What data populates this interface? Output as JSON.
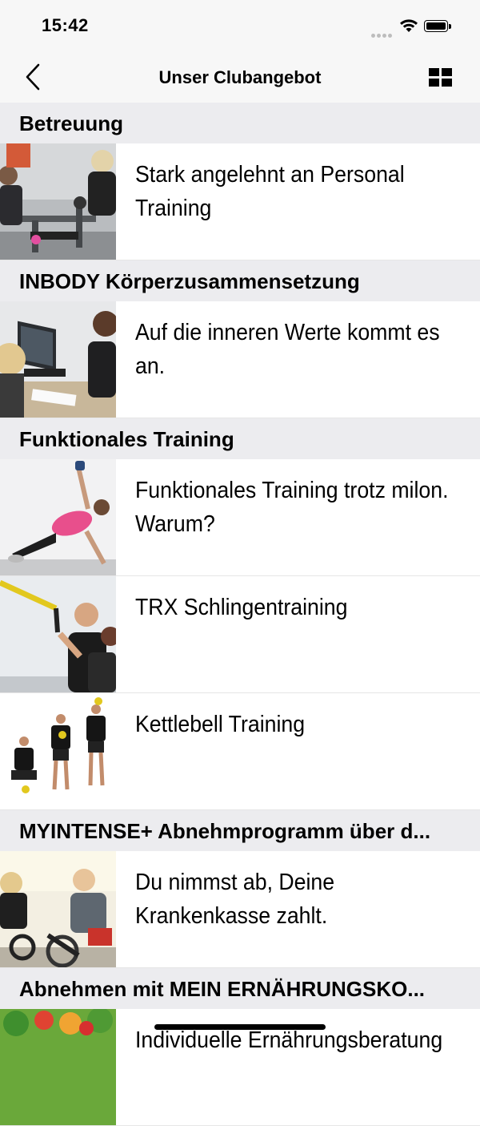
{
  "status_bar": {
    "time": "15:42"
  },
  "nav": {
    "title": "Unser Clubangebot",
    "back_icon": "chevron-left-icon",
    "view_icon": "grid-icon"
  },
  "sections": [
    {
      "title": "Betreuung",
      "items": [
        {
          "text": "Stark angelehnt an Personal Training",
          "image": "personal-training-photo"
        }
      ]
    },
    {
      "title": "INBODY Körperzusammensetzung",
      "items": [
        {
          "text": "Auf die inneren Werte kommt es an.",
          "image": "inbody-consultation-photo"
        }
      ]
    },
    {
      "title": "Funktionales Training",
      "items": [
        {
          "text": "Funktionales Training trotz milon. Warum?",
          "image": "side-plank-kettlebell-photo"
        },
        {
          "text": "TRX Schlingentraining",
          "image": "trx-training-photo"
        },
        {
          "text": "Kettlebell Training",
          "image": "kettlebell-swing-photo"
        }
      ]
    },
    {
      "title": "MYINTENSE+ Abnehmprogramm über d...",
      "items": [
        {
          "text": "Du nimmst ab, Deine Krankenkasse zahlt.",
          "image": "indoor-cycling-photo"
        }
      ]
    },
    {
      "title": "Abnehmen mit MEIN ERNÄHRUNGSKO...",
      "items": [
        {
          "text": "Individuelle Ernährungsberatung",
          "image": "vegetables-photo"
        }
      ]
    }
  ]
}
